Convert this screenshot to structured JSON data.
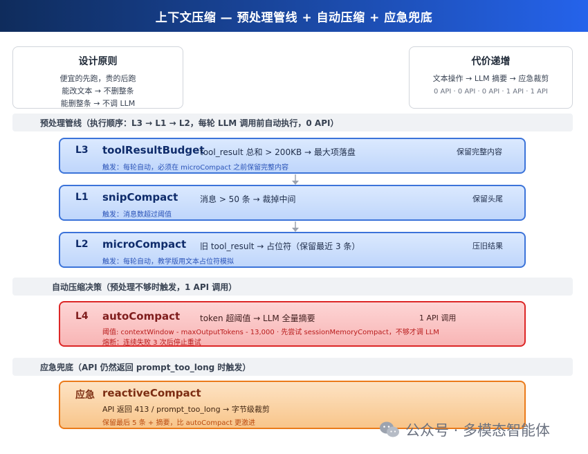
{
  "title": "上下文压缩 — 预处理管线 + 自动压缩 + 应急兜底",
  "principles": {
    "title": "设计原则",
    "lines": [
      "便宜的先跑，贵的后跑",
      "能改文本 → 不删整条",
      "能删整条 → 不调 LLM"
    ]
  },
  "cost": {
    "title": "代价递增",
    "line": "文本操作 → LLM 摘要 → 应急裁剪",
    "sub": "0 API · 0 API · 0 API · 1 API · 1 API"
  },
  "sections": {
    "preprocess": "预处理管线（执行顺序：L3 → L1 → L2，每轮 LLM 调用前自动执行，0 API）",
    "auto": "自动压缩决策（预处理不够时触发，1 API 调用）",
    "emergency": "应急兜底（API 仍然返回 prompt_too_long 时触发）"
  },
  "layers": {
    "l3": {
      "id": "L3",
      "name": "toolResultBudget",
      "desc": "tool_result 总和 > 200KB → 最大项落盘",
      "keep": "保留完整内容",
      "trigger": "触发：每轮自动，必须在 microCompact 之前保留完整内容"
    },
    "l1": {
      "id": "L1",
      "name": "snipCompact",
      "desc": "消息 > 50 条 → 裁掉中间",
      "keep": "保留头尾",
      "trigger": "触发：消息数超过阈值"
    },
    "l2": {
      "id": "L2",
      "name": "microCompact",
      "desc": "旧 tool_result → 占位符（保留最近 3 条）",
      "keep": "压旧结果",
      "trigger": "触发：每轮自动，教学版用文本占位符模拟"
    },
    "l4": {
      "id": "L4",
      "name": "autoCompact",
      "desc": "token 超阈值 → LLM 全量摘要",
      "keep": "1 API 调用",
      "trigger": "阈值: contextWindow - maxOutputTokens - 13,000 · 先尝试 sessionMemoryCompact，不够才调 LLM",
      "trigger2": "熔断：连续失败 3 次后停止重试"
    },
    "emergency": {
      "id": "应急",
      "name": "reactiveCompact",
      "desc": "API 返回 413 / prompt_too_long → 字节级裁剪",
      "trigger": "保留最后 5 条 + 摘要，比 autoCompact 更激进"
    }
  },
  "watermark": "公众号 · 多模态智能体",
  "colors": {
    "header": "#1b4aa8",
    "blue_border": "#3b73d9",
    "red_border": "#dc2626",
    "orange_border": "#ea7a1a"
  }
}
